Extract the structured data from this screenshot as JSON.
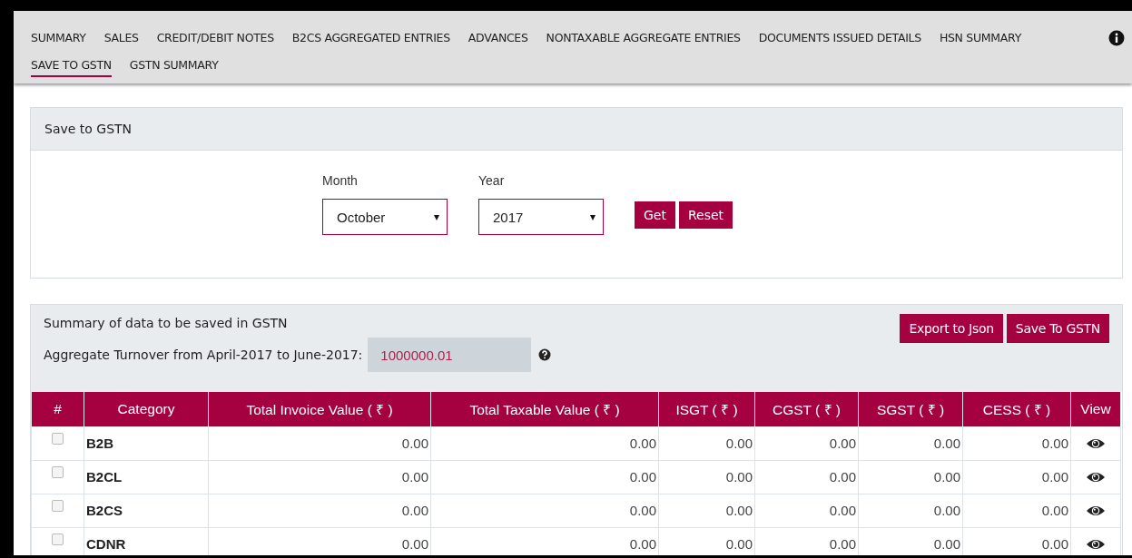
{
  "nav": {
    "tabs": [
      {
        "label": "SUMMARY",
        "selected": false
      },
      {
        "label": "SALES",
        "selected": false
      },
      {
        "label": "CREDIT/DEBIT NOTES",
        "selected": false
      },
      {
        "label": "B2CS AGGREGATED ENTRIES",
        "selected": false
      },
      {
        "label": "ADVANCES",
        "selected": false
      },
      {
        "label": "NONTAXABLE AGGREGATE ENTRIES",
        "selected": false
      },
      {
        "label": "DOCUMENTS ISSUED DETAILS",
        "selected": false
      },
      {
        "label": "HSN SUMMARY",
        "selected": false
      },
      {
        "label": "SAVE TO GSTN",
        "selected": true
      },
      {
        "label": "GSTN SUMMARY",
        "selected": false
      }
    ]
  },
  "filter_panel": {
    "title": "Save to GSTN",
    "month": {
      "label": "Month",
      "value": "October"
    },
    "year": {
      "label": "Year",
      "value": "2017"
    },
    "buttons": [
      "Get",
      "Reset"
    ]
  },
  "summary_panel": {
    "title": "Summary of data to be saved in GSTN",
    "turnover_label": "Aggregate Turnover from April-2017 to June-2017:",
    "turnover_value": "1000000.01",
    "buttons": [
      "Export to Json",
      "Save To GSTN"
    ]
  },
  "table": {
    "columns": [
      "#",
      "Category",
      "Total Invoice Value ( ₹ )",
      "Total Taxable Value ( ₹ )",
      "ISGT ( ₹ )",
      "CGST ( ₹ )",
      "SGST ( ₹ )",
      "CESS ( ₹ )",
      "View"
    ],
    "rows": [
      {
        "checked": false,
        "category": "B2B",
        "values": [
          "0.00",
          "0.00",
          "0.00",
          "0.00",
          "0.00",
          "0.00"
        ]
      },
      {
        "checked": false,
        "category": "B2CL",
        "values": [
          "0.00",
          "0.00",
          "0.00",
          "0.00",
          "0.00",
          "0.00"
        ]
      },
      {
        "checked": false,
        "category": "B2CS",
        "values": [
          "0.00",
          "0.00",
          "0.00",
          "0.00",
          "0.00",
          "0.00"
        ]
      },
      {
        "checked": false,
        "category": "CDNR",
        "values": [
          "0.00",
          "0.00",
          "0.00",
          "0.00",
          "0.00",
          "0.00"
        ]
      }
    ]
  }
}
